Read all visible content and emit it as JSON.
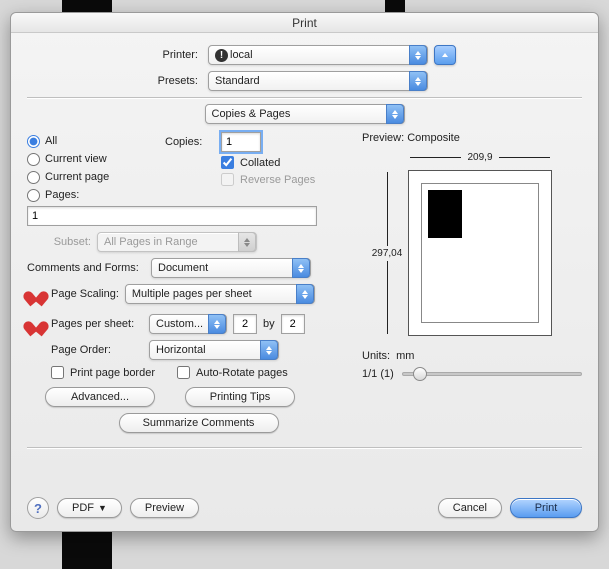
{
  "title": "Print",
  "printerRow": {
    "label": "Printer:",
    "value": "local"
  },
  "presetsRow": {
    "label": "Presets:",
    "value": "Standard"
  },
  "section": {
    "value": "Copies & Pages"
  },
  "range": {
    "all": "All",
    "currentView": "Current view",
    "currentPage": "Current page",
    "pages": "Pages:",
    "pagesValue": "1",
    "subsetLabel": "Subset:",
    "subsetValue": "All Pages in Range"
  },
  "copies": {
    "label": "Copies:",
    "value": "1",
    "collated": "Collated",
    "reverse": "Reverse Pages"
  },
  "comments": {
    "label": "Comments and Forms:",
    "value": "Document"
  },
  "scaling": {
    "label": "Page Scaling:",
    "value": "Multiple pages per sheet"
  },
  "pps": {
    "label": "Pages per sheet:",
    "custom": "Custom...",
    "w": "2",
    "by": "by",
    "h": "2"
  },
  "order": {
    "label": "Page Order:",
    "value": "Horizontal"
  },
  "checks": {
    "border": "Print page border",
    "autorotate": "Auto-Rotate pages"
  },
  "buttons": {
    "advanced": "Advanced...",
    "tips": "Printing Tips",
    "summarize": "Summarize Comments",
    "pdf": "PDF",
    "preview": "Preview",
    "cancel": "Cancel",
    "print": "Print"
  },
  "preview": {
    "title": "Preview: Composite",
    "width": "209,9",
    "height": "297,04",
    "unitsLabel": "Units:",
    "units": "mm",
    "counter": "1/1 (1)"
  }
}
